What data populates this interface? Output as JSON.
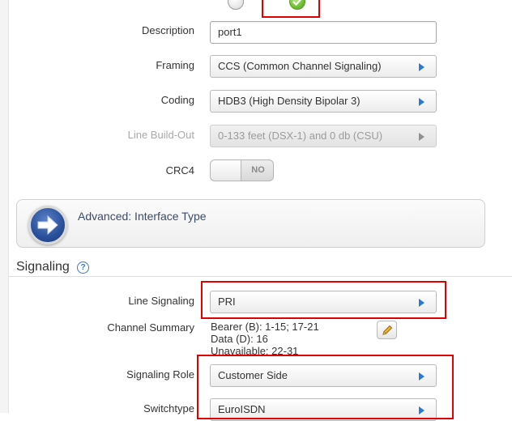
{
  "form": {
    "description": {
      "label": "Description",
      "value": "port1"
    },
    "framing": {
      "label": "Framing",
      "value": "CCS (Common Channel Signaling)"
    },
    "coding": {
      "label": "Coding",
      "value": "HDB3 (High Density Bipolar 3)"
    },
    "line_build_out": {
      "label": "Line Build-Out",
      "value": "0-133 feet (DSX-1) and 0 db (CSU)",
      "disabled": true
    },
    "crc4": {
      "label": "CRC4",
      "state": "NO"
    }
  },
  "advanced": {
    "label": "Advanced: Interface Type",
    "icon": "arrow-right-circle-icon"
  },
  "signaling": {
    "title": "Signaling",
    "help_icon": "?",
    "line_signaling": {
      "label": "Line Signaling",
      "value": "PRI"
    },
    "channel_summary": {
      "label": "Channel Summary",
      "lines": [
        "Bearer (B): 1-15; 17-21",
        "Data (D): 16",
        "Unavailable: 22-31"
      ]
    },
    "signaling_role": {
      "label": "Signaling Role",
      "value": "Customer Side"
    },
    "switchtype": {
      "label": "Switchtype",
      "value": "EuroISDN"
    }
  },
  "colors": {
    "accent": "#2b79d6",
    "highlight": "#e00000",
    "check_green": "#6fbf36"
  }
}
